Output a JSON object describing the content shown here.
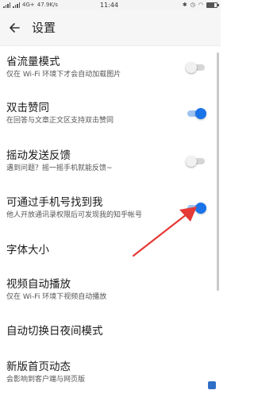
{
  "status_bar": {
    "network": "4G+",
    "speed": "47.9K/s",
    "time": "11:44"
  },
  "header": {
    "title": "设置"
  },
  "settings": [
    {
      "title": "省流量模式",
      "subtitle": "仅在 Wi-Fi 环境下才会自动加载图片",
      "toggle": "off"
    },
    {
      "title": "双击赞同",
      "subtitle": "在回答与文章正文区支持双击赞同",
      "toggle": "on"
    },
    {
      "title": "摇动发送反馈",
      "subtitle": "遇到问题？摇一摇手机就能反馈~",
      "toggle": "off"
    },
    {
      "title": "可通过手机号找到我",
      "subtitle": "他人开放通讯录权限后可发现我的知乎帐号",
      "toggle": "on"
    },
    {
      "title": "字体大小"
    },
    {
      "title": "视频自动播放",
      "subtitle": "仅在 Wi-Fi 环境下视频自动播放"
    },
    {
      "title": "自动切换日夜间模式"
    },
    {
      "title": "新版首页动态",
      "subtitle": "会影响到客户端与网页版"
    }
  ],
  "colors": {
    "accent": "#1a73e8",
    "annotation": "#e53935"
  }
}
